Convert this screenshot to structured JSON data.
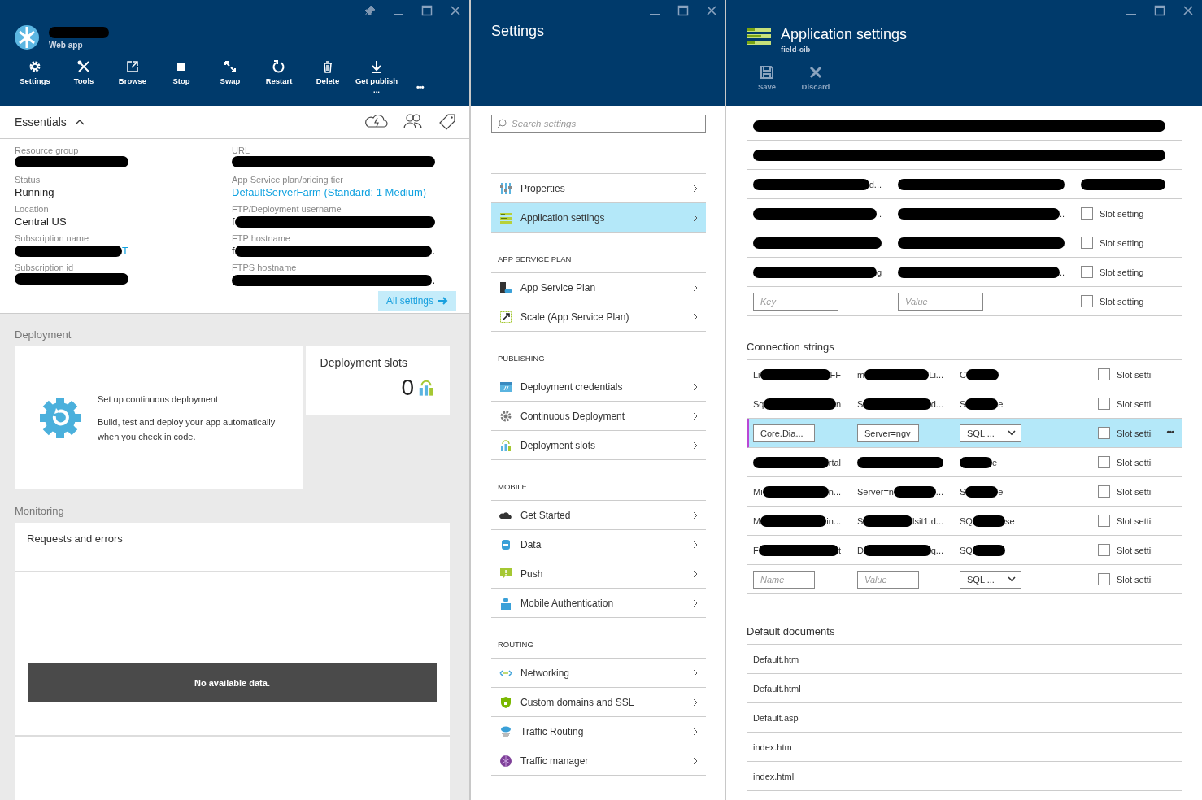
{
  "web_app_blade": {
    "title": {
      "redacted": true
    },
    "subtitle": "Web app",
    "commands": [
      {
        "label": "Settings"
      },
      {
        "label": "Tools"
      },
      {
        "label": "Browse"
      },
      {
        "label": "Stop"
      },
      {
        "label": "Swap"
      },
      {
        "label": "Restart"
      },
      {
        "label": "Delete"
      },
      {
        "label": "Get publish ..."
      }
    ],
    "more": "•••",
    "essentials": {
      "label": "Essentials",
      "expanded": true
    },
    "properties": {
      "left": [
        {
          "label": "Resource group",
          "value": {
            "redacted": true
          }
        },
        {
          "label": "Status",
          "value": {
            "text": "Running"
          },
          "link": false
        },
        {
          "label": "Location",
          "value": {
            "text": "Central US"
          },
          "link": false
        },
        {
          "label": "Subscription name",
          "value": {
            "redacted": true,
            "post": "T"
          },
          "link": true
        },
        {
          "label": "Subscription id",
          "value": {
            "redacted": true
          }
        }
      ],
      "right": [
        {
          "label": "URL",
          "value": {
            "redacted": true
          }
        },
        {
          "label": "App Service plan/pricing tier",
          "value": {
            "text": "DefaultServerFarm (Standard: 1 Medium)"
          },
          "link": true
        },
        {
          "label": "FTP/Deployment username",
          "value": {
            "redacted": true,
            "pre": "f"
          },
          "link": false
        },
        {
          "label": "FTP hostname",
          "value": {
            "redacted": true,
            "pre": "f",
            "post": "."
          },
          "link": false
        },
        {
          "label": "FTPS hostname",
          "value": {
            "redacted": true,
            "post": "."
          },
          "link": false
        }
      ]
    },
    "all_settings": "All settings",
    "deployment": {
      "heading": "Deployment",
      "setup_title": "Set up continuous deployment",
      "setup_text": "Build, test and deploy your app automatically when you check in code.",
      "slots_title": "Deployment slots",
      "slots_count": "0"
    },
    "monitoring": {
      "heading": "Monitoring",
      "chart_title": "Requests and errors",
      "empty_message": "No available data."
    }
  },
  "settings_blade": {
    "title": "Settings",
    "search": {
      "placeholder": "Search settings"
    },
    "groups": [
      {
        "items": [
          {
            "label": "Properties",
            "selected": false
          },
          {
            "label": "Application settings",
            "selected": true
          }
        ]
      },
      {
        "heading": "APP SERVICE PLAN",
        "items": [
          {
            "label": "App Service Plan",
            "selected": false
          },
          {
            "label": "Scale (App Service Plan)",
            "selected": false
          }
        ]
      },
      {
        "heading": "PUBLISHING",
        "items": [
          {
            "label": "Deployment credentials",
            "selected": false
          },
          {
            "label": "Continuous Deployment",
            "selected": false
          },
          {
            "label": "Deployment slots",
            "selected": false
          }
        ]
      },
      {
        "heading": "MOBILE",
        "items": [
          {
            "label": "Get Started",
            "selected": false
          },
          {
            "label": "Data",
            "selected": false
          },
          {
            "label": "Push",
            "selected": false
          },
          {
            "label": "Mobile Authentication",
            "selected": false
          }
        ]
      },
      {
        "heading": "ROUTING",
        "items": [
          {
            "label": "Networking",
            "selected": false
          },
          {
            "label": "Custom domains and SSL",
            "selected": false
          },
          {
            "label": "Traffic Routing",
            "selected": false
          },
          {
            "label": "Traffic manager",
            "selected": false
          }
        ]
      }
    ]
  },
  "app_settings_blade": {
    "title": "Application settings",
    "subtitle": "field-cib",
    "commands": [
      {
        "label": "Save",
        "disabled": true
      },
      {
        "label": "Discard",
        "disabled": true
      }
    ],
    "app_settings": [
      {
        "kind": "redacted"
      },
      {
        "kind": "redacted"
      },
      {
        "kind": "entry",
        "key": {
          "redacted": true,
          "post": "d..."
        },
        "value": {
          "redacted": true
        },
        "slot": {
          "redacted": true
        }
      },
      {
        "kind": "entry",
        "key": {
          "redacted": true,
          "post": ".."
        },
        "value": {
          "redacted": true,
          "post": ".."
        },
        "slot": {
          "checked": false,
          "label": "Slot setting"
        }
      },
      {
        "kind": "entry",
        "key": {
          "redacted": true
        },
        "value": {
          "redacted": true
        },
        "slot": {
          "checked": false,
          "label": "Slot setting"
        }
      },
      {
        "kind": "entry",
        "key": {
          "redacted": true,
          "post": "g"
        },
        "value": {
          "redacted": true,
          "post": ".."
        },
        "slot": {
          "checked": false,
          "label": "Slot setting"
        }
      },
      {
        "kind": "new",
        "key_placeholder": "Key",
        "value_placeholder": "Value",
        "slot": {
          "checked": false,
          "label": "Slot setting"
        }
      }
    ],
    "connection_strings": {
      "heading": "Connection strings",
      "rows": [
        {
          "kind": "entry",
          "selected": false,
          "name": {
            "redacted": true,
            "pre": "Li",
            "post": "FF"
          },
          "value": {
            "redacted": true,
            "pre": "m",
            "post": "Li..."
          },
          "type": {
            "redacted": true,
            "pre": "C"
          },
          "slot": {
            "checked": false,
            "label": "Slot settii"
          }
        },
        {
          "kind": "entry",
          "selected": false,
          "name": {
            "redacted": true,
            "pre": "Sq",
            "post": "n"
          },
          "value": {
            "redacted": true,
            "pre": "S",
            "post": "d..."
          },
          "type": {
            "redacted": true,
            "pre": "S",
            "post": "e"
          },
          "slot": {
            "checked": false,
            "label": "Slot settii"
          }
        },
        {
          "kind": "entry",
          "selected": true,
          "name": {
            "text": "Core.Dia..."
          },
          "value": {
            "text": "Server=ngv"
          },
          "type": {
            "text": "SQL ..."
          },
          "slot": {
            "checked": false,
            "label": "Slot settii"
          },
          "more": "•••"
        },
        {
          "kind": "entry",
          "selected": false,
          "name": {
            "redacted": true,
            "post": "rtal"
          },
          "value": {
            "redacted": true
          },
          "type": {
            "redacted": true,
            "post": "e"
          },
          "slot": {
            "checked": false,
            "label": "Slot settii"
          }
        },
        {
          "kind": "entry",
          "selected": false,
          "name": {
            "redacted": true,
            "pre": "Mi",
            "post": "n..."
          },
          "value": {
            "redacted": true,
            "pre": "Server=n",
            "post": "..."
          },
          "type": {
            "redacted": true,
            "pre": "S",
            "post": "e"
          },
          "slot": {
            "checked": false,
            "label": "Slot settii"
          }
        },
        {
          "kind": "entry",
          "selected": false,
          "name": {
            "redacted": true,
            "pre": "M",
            "post": "in..."
          },
          "value": {
            "redacted": true,
            "pre": "S",
            "post": "lsit1.d..."
          },
          "type": {
            "redacted": true,
            "pre": "SQ",
            "post": "se"
          },
          "slot": {
            "checked": false,
            "label": "Slot settii"
          }
        },
        {
          "kind": "entry",
          "selected": false,
          "name": {
            "redacted": true,
            "pre": "F",
            "post": "t"
          },
          "value": {
            "redacted": true,
            "pre": "D",
            "post": "q..."
          },
          "type": {
            "redacted": true,
            "pre": "SQ"
          },
          "slot": {
            "checked": false,
            "label": "Slot settii"
          }
        },
        {
          "kind": "new",
          "selected": false,
          "name_placeholder": "Name",
          "value_placeholder": "Value",
          "type": {
            "text": "SQL ..."
          },
          "slot": {
            "checked": false,
            "label": "Slot settii"
          }
        }
      ]
    },
    "default_documents": {
      "heading": "Default documents",
      "items": [
        "Default.htm",
        "Default.html",
        "Default.asp",
        "index.htm",
        "index.html"
      ]
    }
  }
}
